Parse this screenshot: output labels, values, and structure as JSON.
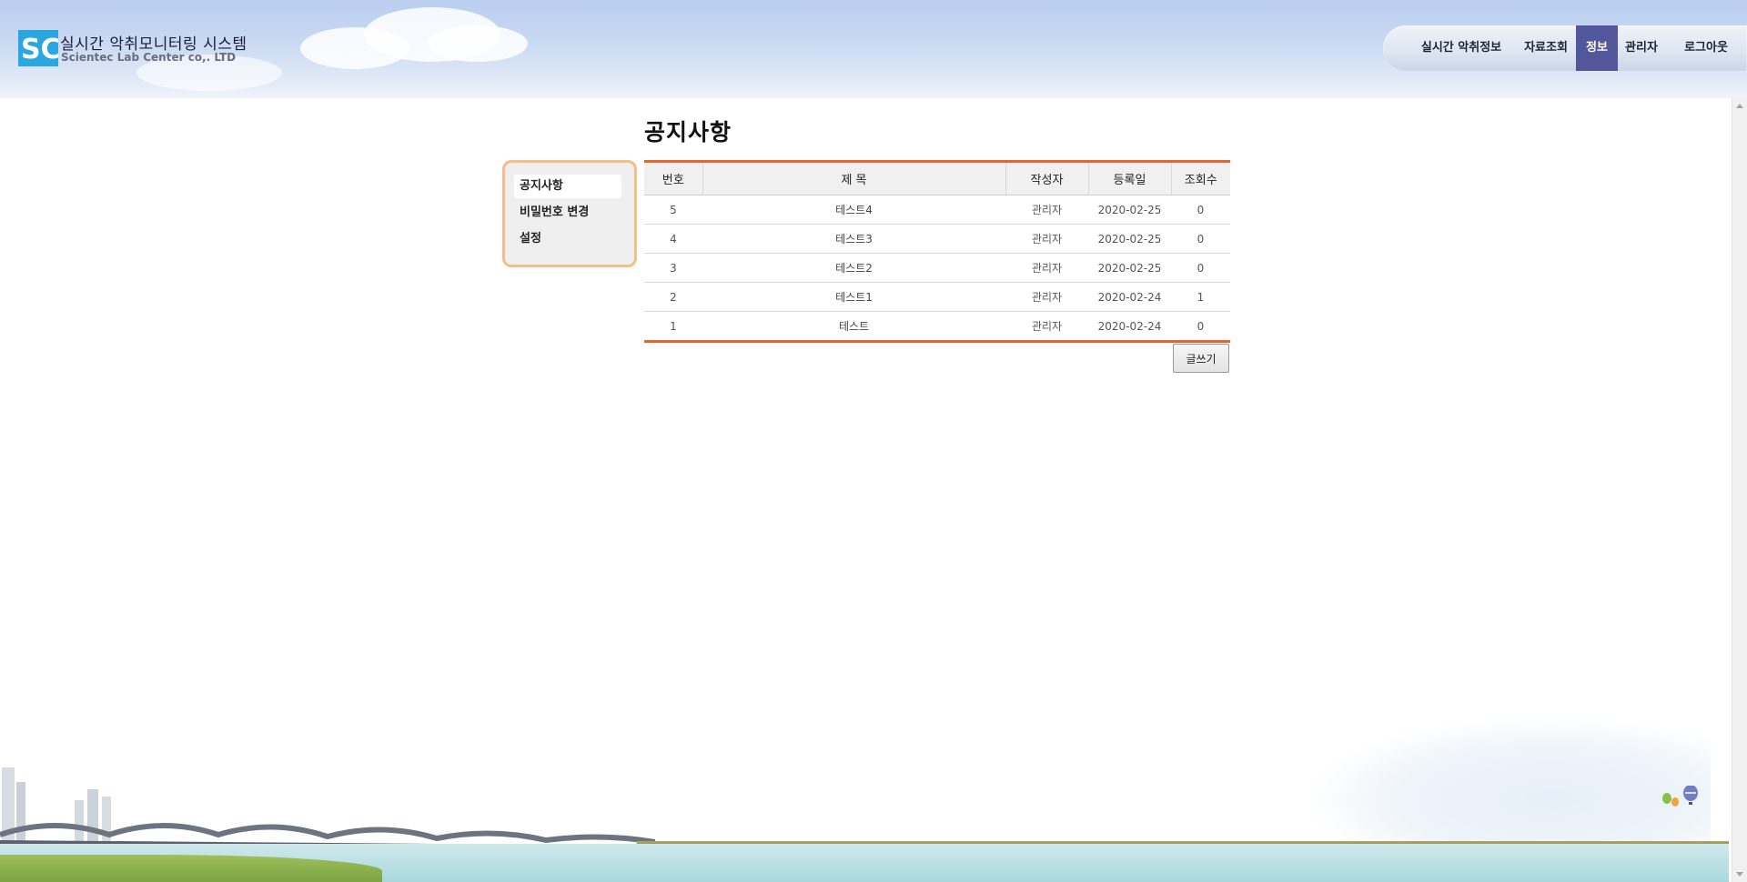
{
  "header": {
    "logo_text": "SC",
    "title": "실시간 악취모니터링 시스템",
    "subtitle": "Scientec Lab Center co,. LTD"
  },
  "nav": {
    "items": [
      {
        "label": "실시간 악취정보",
        "active": false
      },
      {
        "label": "자료조회",
        "active": false
      },
      {
        "label": "정보",
        "active": true
      },
      {
        "label": "관리자",
        "active": false
      },
      {
        "label": "로그아웃",
        "active": false
      }
    ]
  },
  "sidebar": {
    "items": [
      {
        "label": "공지사항",
        "active": true
      },
      {
        "label": "비밀번호 변경",
        "active": false
      },
      {
        "label": "설정",
        "active": false
      }
    ]
  },
  "main": {
    "title": "공지사항",
    "table": {
      "headers": [
        "번호",
        "제 목",
        "작성자",
        "등록일",
        "조회수"
      ],
      "rows": [
        [
          "5",
          "테스트4",
          "관리자",
          "2020-02-25",
          "0"
        ],
        [
          "4",
          "테스트3",
          "관리자",
          "2020-02-25",
          "0"
        ],
        [
          "3",
          "테스트2",
          "관리자",
          "2020-02-25",
          "0"
        ],
        [
          "2",
          "테스트1",
          "관리자",
          "2020-02-24",
          "1"
        ],
        [
          "1",
          "테스트",
          "관리자",
          "2020-02-24",
          "0"
        ]
      ]
    },
    "write_button": "글쓰기"
  },
  "colors": {
    "accent": "#e2672f",
    "nav_active": "#52569a",
    "sidebar_border": "#f7bd86"
  }
}
